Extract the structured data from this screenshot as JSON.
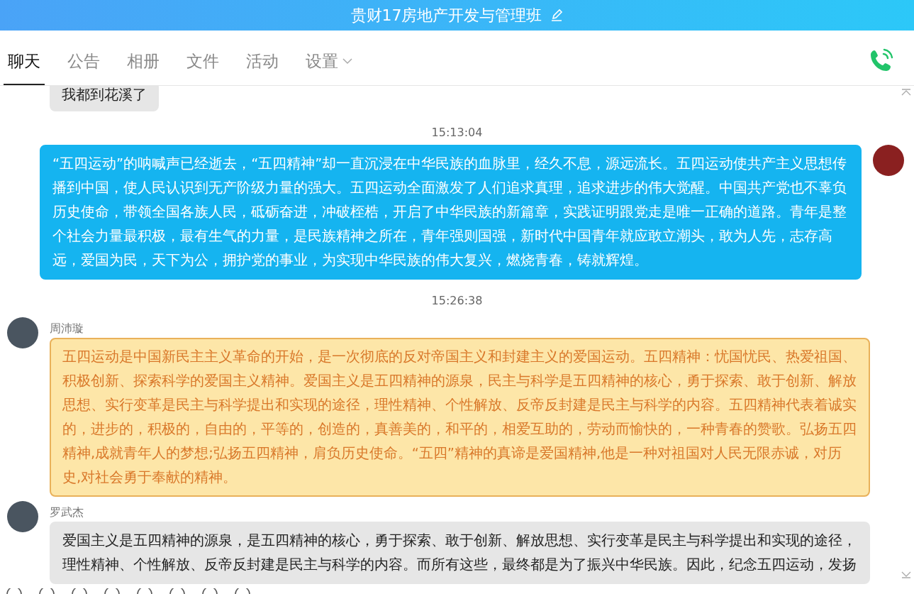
{
  "window": {
    "title": "贵财17房地产开发与管理班"
  },
  "tabs": [
    {
      "label": "聊天",
      "selected": true
    },
    {
      "label": "公告",
      "selected": false
    },
    {
      "label": "相册",
      "selected": false
    },
    {
      "label": "文件",
      "selected": false
    },
    {
      "label": "活动",
      "selected": false
    },
    {
      "label": "设置",
      "selected": false,
      "kind": "menu"
    }
  ],
  "messages": [
    {
      "kind": "received",
      "text": "我都到花溪了"
    },
    {
      "kind": "time",
      "text": "15:13:04"
    },
    {
      "kind": "sent",
      "text": "“五四运动”的呐喊声已经逝去，“五四精神”却一直沉浸在中华民族的血脉里，经久不息，源远流长。五四运动使共产主义思想传播到中国，使人民认识到无产阶级力量的强大。五四运动全面激发了人们追求真理，追求进步的伟大觉醒。中国共产党也不辜负历史使命，带领全国各族人民，砥砺奋进，冲破桎梏，开启了中华民族的新篇章，实践证明跟党走是唯一正确的道路。青年是整个社会力量最积极，最有生气的力量，是民族精神之所在，青年强则国强，新时代中国青年就应敢立潮头，敢为人先，志存高远，爱国为民，天下为公，拥护党的事业，为实现中华民族的伟大复兴，燃烧青春，铸就辉煌。"
    },
    {
      "kind": "time",
      "text": "15:26:38"
    },
    {
      "kind": "themed",
      "sender": "周沛璇",
      "text": "五四运动是中国新民主主义革命的开始，是一次彻底的反对帝国主义和封建主义的爱国运动。五四精神：忧国忧民、热爱祖国、积极创新、探索科学的爱国主义精神。爱国主义是五四精神的源泉，民主与科学是五四精神的核心，勇于探索、敢于创新、解放思想、实行变革是民主与科学提出和实现的途径，理性精神、个性解放、反帝反封建是民主与科学的内容。五四精神代表着诚实的，进步的，积极的，自由的，平等的，创造的，真善美的，和平的，相爱互助的，劳动而愉快的，一种青春的赞歌。弘扬五四精神,成就青年人的梦想;弘扬五四精神，肩负历史使命。“五四”精神的真谛是爱国精神,他是一种对祖国对人民无限赤诚，对历史,对社会勇于奉献的精神。"
    },
    {
      "kind": "received",
      "sender": "罗武杰",
      "text": "爱国主义是五四精神的源泉，是五四精神的核心，勇于探索、敢于创新、解放思想、实行变革是民主与科学提出和实现的途径，理性精神、个性解放、反帝反封建是民主与科学的内容。而所有这些，最终都是为了振兴中华民族。因此，纪念五四运动，发扬"
    }
  ]
}
